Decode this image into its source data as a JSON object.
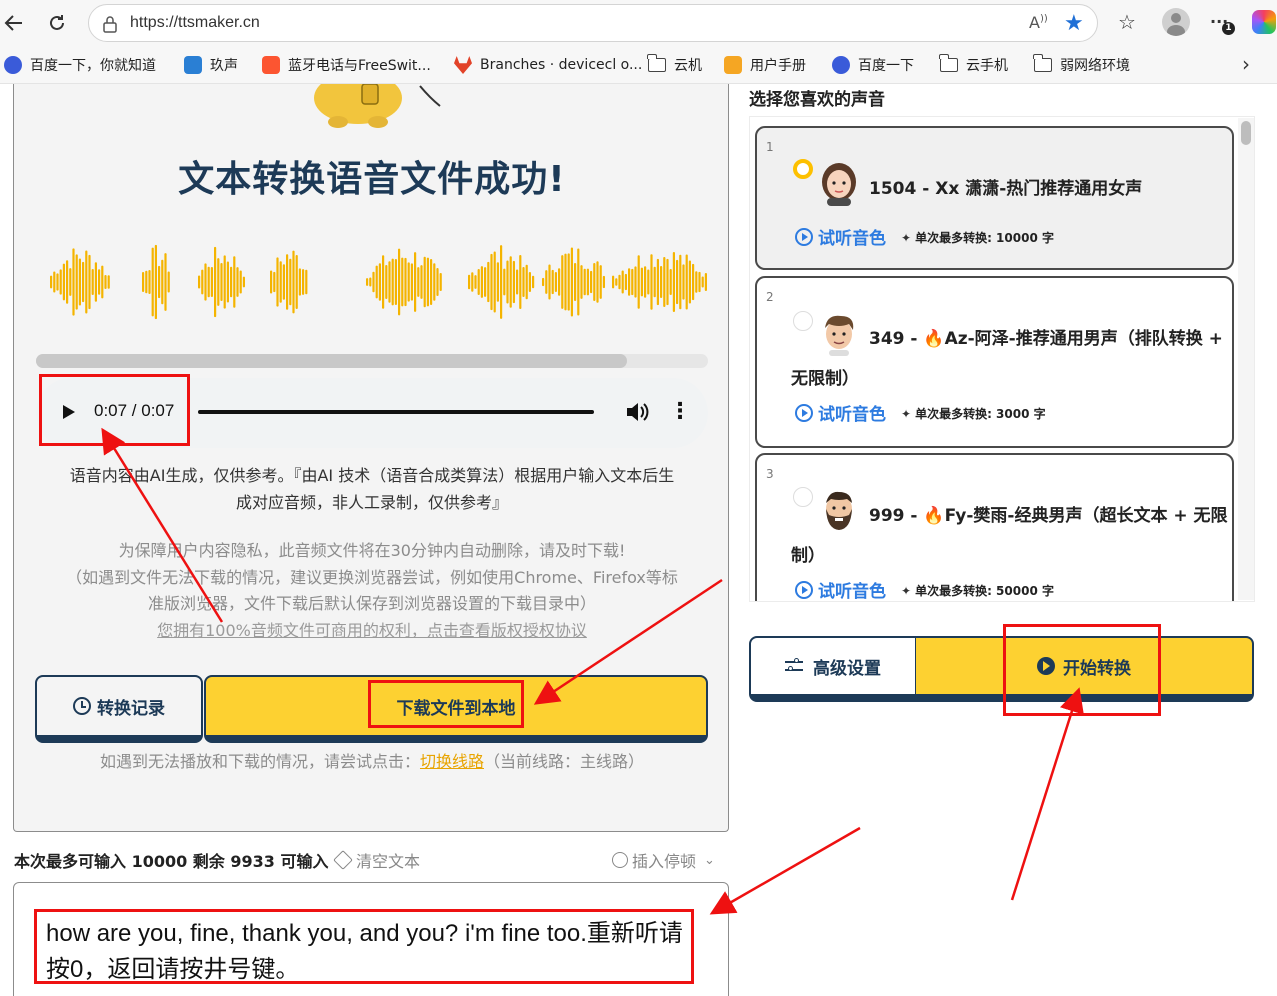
{
  "browser": {
    "url": "https://ttsmaker.cn",
    "bookmarks": [
      {
        "label": "百度一下，你就知道",
        "icon": "baidu-icon",
        "color": "#3a5bd9"
      },
      {
        "label": "玖声",
        "icon": "phone-icon",
        "color": "#2a7fd4"
      },
      {
        "label": "蓝牙电话与FreeSwit...",
        "icon": "csdn-icon",
        "color": "#fc5531"
      },
      {
        "label": "Branches · devicecl o...",
        "icon": "gitlab-icon",
        "color": "#e24329"
      },
      {
        "label": "云机",
        "icon": "folder-icon",
        "color": "#444444"
      },
      {
        "label": "用户手册",
        "icon": "manual-icon",
        "color": "#f5a623"
      },
      {
        "label": "百度一下",
        "icon": "baidu-icon",
        "color": "#3a5bd9"
      },
      {
        "label": "云手机",
        "icon": "folder-icon",
        "color": "#444444"
      },
      {
        "label": "弱网络环境",
        "icon": "folder-icon",
        "color": "#444444"
      }
    ]
  },
  "result": {
    "title": "文本转换语音文件成功!",
    "player": {
      "time": "0:07 / 0:07"
    },
    "download_progress": 0.88,
    "disclaimer_line1": "语音内容由AI生成，仅供参考。『由AI 技术（语音合成类算法）根据用户输入文本后生",
    "disclaimer_line2": "成对应音频，非人工录制，仅供参考』",
    "privacy_line1": "为保障用户内容隐私，此音频文件将在30分钟内自动删除，请及时下载!",
    "privacy_line2": "（如遇到文件无法下载的情况，建议更换浏览器尝试，例如使用Chrome、Firefox等标",
    "privacy_line3": "准版浏览器，文件下载后默认保存到浏览器设置的下载目录中）",
    "rights_link": "您拥有100%音频文件可商用的权利，点击查看版权授权协议",
    "history_label": "转换记录",
    "download_label": "下载文件到本地",
    "route_note_prefix": "如遇到无法播放和下载的情况，请尝试点击：",
    "route_switch": "切换线路",
    "route_note_suffix": "（当前线路：主线路）"
  },
  "input": {
    "limit_text": "本次最多可输入 10000 剩余 9933 可输入",
    "clear_label": "清空文本",
    "pause_label": "插入停顿",
    "text": "how are you, fine, thank you, and you? i'm fine too.重新听请按0，返回请按井号键。"
  },
  "voices": {
    "heading": "选择您喜欢的声音",
    "listen_label": "试听音色",
    "items": [
      {
        "num": "1",
        "name": "1504 - Xx 潇潇-热门推荐通用女声",
        "name_cont": "",
        "limit": "单次最多转换: 10000 字",
        "selected": true,
        "hot": false
      },
      {
        "num": "2",
        "name": "349 - ",
        "name_main": "Az-阿泽-推荐通用男声（排队转换 +",
        "name_cont": "无限制）",
        "limit": "单次最多转换: 3000 字",
        "selected": false,
        "hot": true
      },
      {
        "num": "3",
        "name": "999 - ",
        "name_main": "Fy-樊雨-经典男声（超长文本 + 无限",
        "name_cont": "制）",
        "limit": "单次最多转换: 50000 字",
        "selected": false,
        "hot": true
      }
    ]
  },
  "actions": {
    "advanced_label": "高级设置",
    "start_label": "开始转换"
  },
  "colors": {
    "accent_yellow": "#fdd131",
    "navy": "#1d3a57",
    "link_blue": "#2d7be0",
    "annotation_red": "#e11111"
  }
}
